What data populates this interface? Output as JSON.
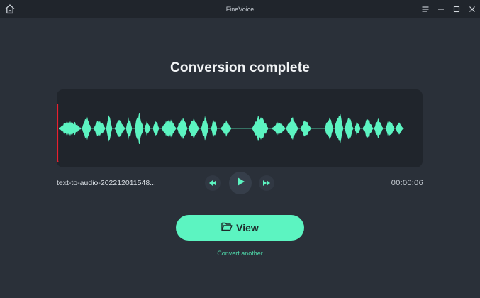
{
  "window": {
    "title": "FineVoice",
    "accent_color": "#5cf4c1",
    "background_color": "#2a3039"
  },
  "titlebar": {
    "home_icon": "home-icon",
    "menu_icon": "hamburger-menu-icon",
    "minimize_icon": "minimize-icon",
    "maximize_icon": "maximize-icon",
    "close_icon": "close-icon"
  },
  "main": {
    "heading": "Conversion complete",
    "file_name": "text-to-audio-202212011548...",
    "duration": "00:00:06",
    "playhead_color": "#e8202f",
    "waveform_color": "#5cf4c1"
  },
  "player": {
    "rewind_icon": "rewind-icon",
    "play_icon": "play-icon",
    "forward_icon": "fast-forward-icon"
  },
  "actions": {
    "view_label": "View",
    "view_icon": "folder-open-icon",
    "convert_another_label": "Convert another"
  }
}
